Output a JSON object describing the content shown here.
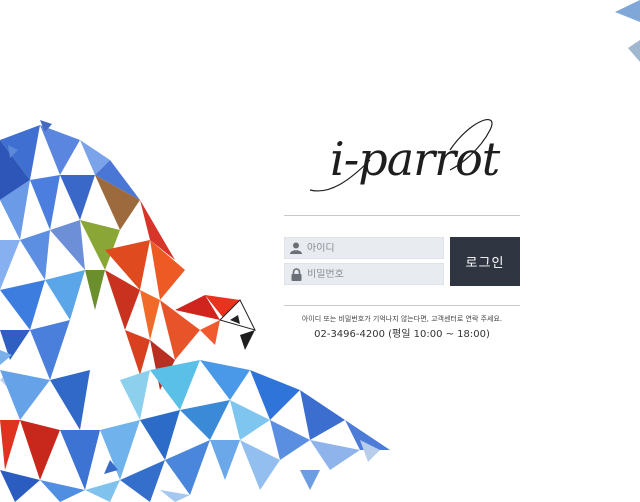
{
  "brand": {
    "logo_text": "i-parrot"
  },
  "login": {
    "id_placeholder": "아이디",
    "password_placeholder": "비밀번호",
    "button_label": "로그인"
  },
  "help": {
    "message": "아이디 또는 비밀번호가 기억나지 않는다면, 고객센터로 연락 주세요.",
    "phone": "02-3496-4200 (평일 10:00 ~ 18:00)"
  },
  "icons": {
    "id_field": "user-icon",
    "password_field": "lock-icon"
  }
}
